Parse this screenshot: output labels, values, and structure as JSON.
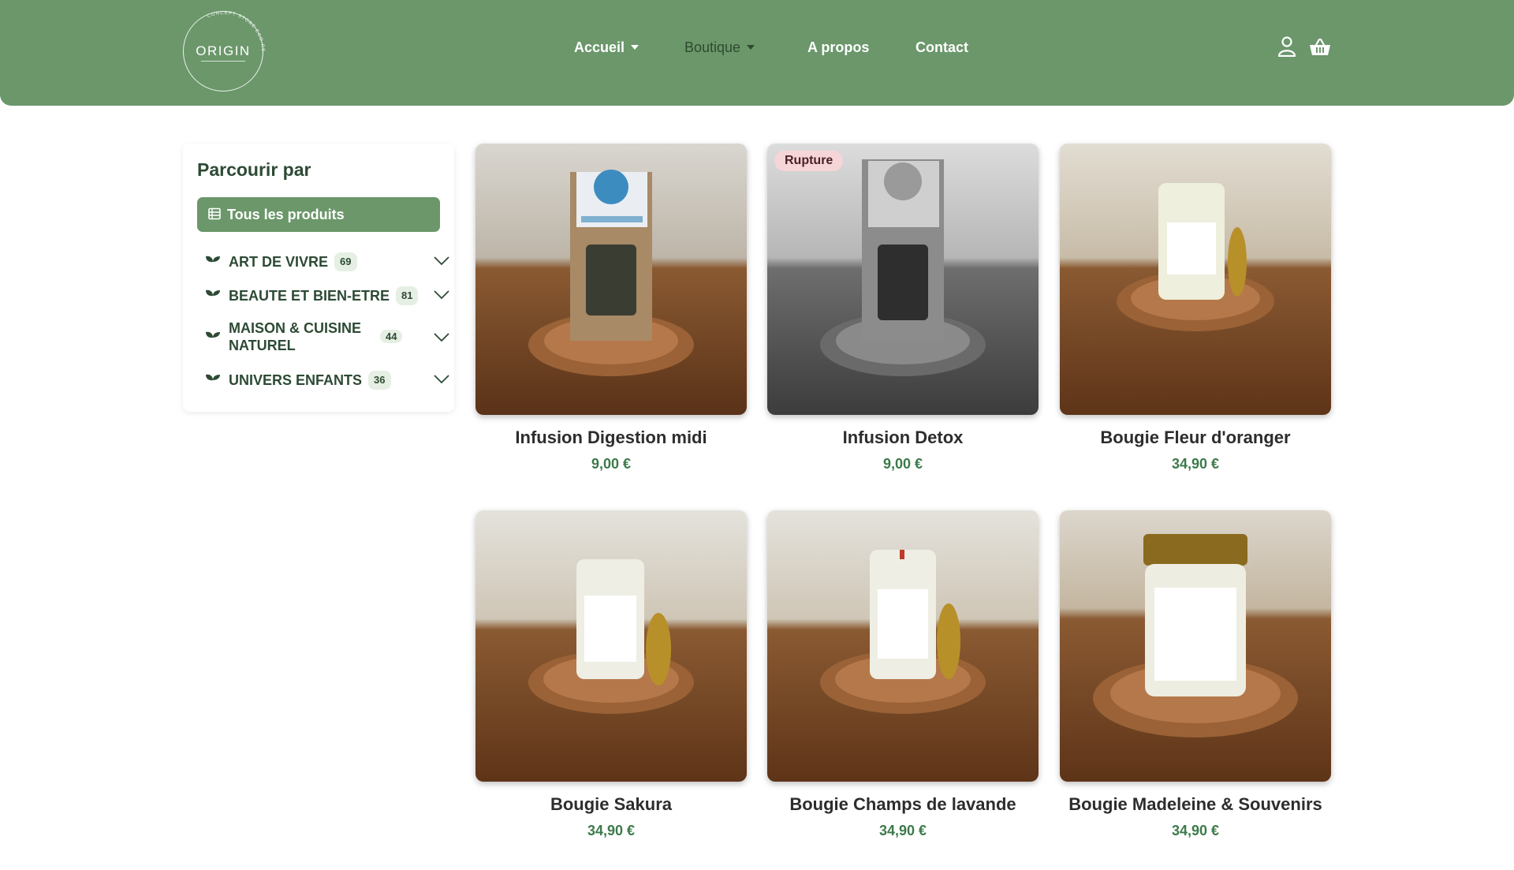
{
  "brand": {
    "name": "ORIGIN",
    "ring_text": "CONCEPT STORE ECO-RESPONSABLE"
  },
  "nav": {
    "items": [
      {
        "label": "Accueil",
        "dropdown": true
      },
      {
        "label": "Boutique",
        "dropdown": true
      },
      {
        "label": "A propos",
        "dropdown": false
      },
      {
        "label": "Contact",
        "dropdown": false
      }
    ],
    "icons": [
      "user-icon",
      "basket-icon"
    ]
  },
  "sidebar": {
    "title": "Parcourir par",
    "all_products": "Tous les produits",
    "categories": [
      {
        "name": "ART DE VIVRE",
        "count": "69"
      },
      {
        "name": "BEAUTE ET BIEN-ETRE",
        "count": "81"
      },
      {
        "name": "MAISON & CUISINE NATUREL",
        "count": "44"
      },
      {
        "name": "UNIVERS ENFANTS",
        "count": "36"
      }
    ]
  },
  "products": [
    {
      "name": "Infusion Digestion midi",
      "price": "9,00 €",
      "badge": "",
      "image": "tea-bag-photo"
    },
    {
      "name": "Infusion Detox",
      "price": "9,00 €",
      "badge": "Rupture",
      "image": "tea-bag-photo-greyscale"
    },
    {
      "name": "Bougie Fleur d'oranger",
      "price": "34,90 €",
      "badge": "",
      "image": "candle-jar-photo"
    },
    {
      "name": "Bougie Sakura",
      "price": "34,90 €",
      "badge": "",
      "image": "candle-jar-photo"
    },
    {
      "name": "Bougie Champs de lavande",
      "price": "34,90 €",
      "badge": "",
      "image": "candle-jar-photo"
    },
    {
      "name": "Bougie Madeleine & Souvenirs",
      "price": "34,90 €",
      "badge": "",
      "image": "large-candle-jar-photo"
    }
  ],
  "colors": {
    "header_bg": "#6b976b",
    "accent": "#6b976b",
    "price": "#3c7a4a",
    "badge_rupture_bg": "#f6d5d8",
    "title": "#2d4a34"
  }
}
